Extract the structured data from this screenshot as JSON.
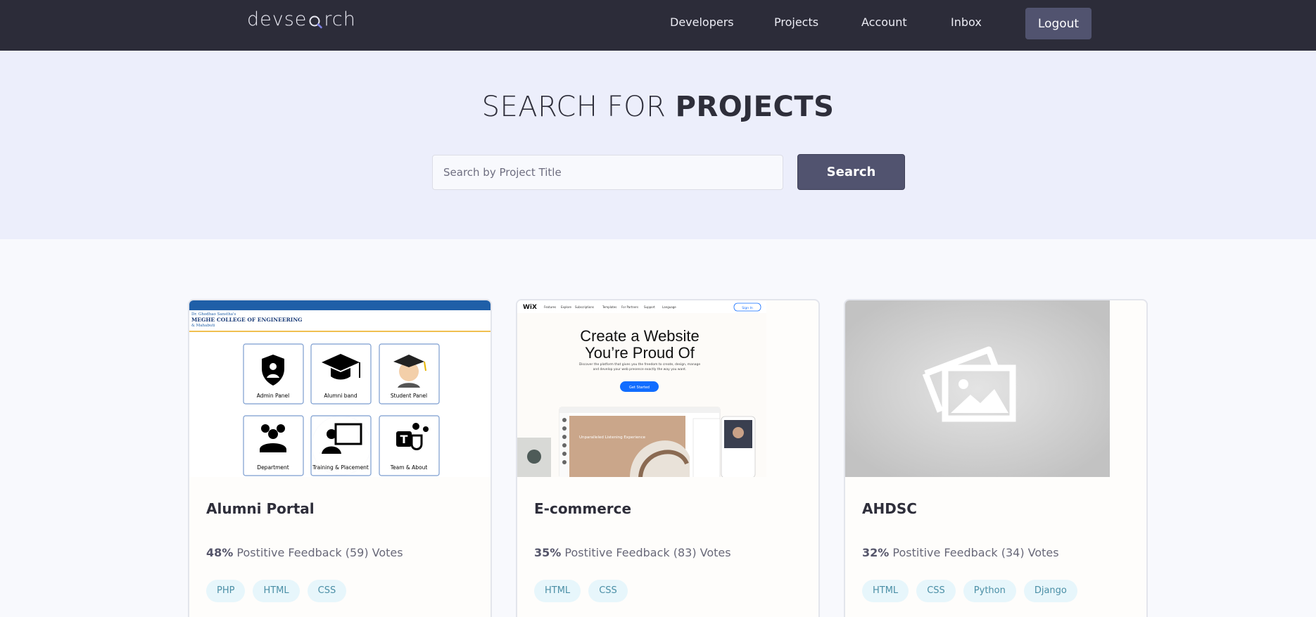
{
  "nav": {
    "logo": {
      "before": "devse",
      "after": "rch"
    },
    "links": [
      "Developers",
      "Projects",
      "Account",
      "Inbox"
    ],
    "logout": "Logout"
  },
  "hero": {
    "title_light": "SEARCH FOR",
    "title_bold": "PROJECTS",
    "search_placeholder": "Search by Project Title",
    "search_button": "Search"
  },
  "projects": [
    {
      "title": "Alumni Portal",
      "percent": "48%",
      "feedback": "Postitive Feedback (59) Votes",
      "tags": [
        "PHP",
        "HTML",
        "CSS"
      ],
      "thumb": {
        "header_small": "Dr. Ghodhao Sanstha's",
        "header_main": "MEGHE COLLEGE OF ENGINEERING",
        "header_sub": "& Mahabuti",
        "tiles": [
          "Admin Panel",
          "Alumni band",
          "Student Panel",
          "Department",
          "Training & Placement",
          "Team & About"
        ]
      }
    },
    {
      "title": "E-commerce",
      "percent": "35%",
      "feedback": "Postitive Feedback (83) Votes",
      "tags": [
        "HTML",
        "CSS"
      ],
      "thumb": {
        "brand": "WiX",
        "menu": [
          "Features",
          "Explore",
          "Subscriptions",
          "Templates",
          "For Partners",
          "Support",
          "Language"
        ],
        "signin": "Sign In",
        "headline_1": "Create a Website",
        "headline_2": "You’re Proud Of",
        "body": "Discover the platform that gives you the freedom to create, design, manage and develop your web presence exactly the way you want.",
        "cta": "Get Started",
        "panel_text": "Unparalleled Listening Experience"
      }
    },
    {
      "title": "AHDSC",
      "percent": "32%",
      "feedback": "Postitive Feedback (34) Votes",
      "tags": [
        "HTML",
        "CSS",
        "Python",
        "Django"
      ],
      "thumb": {
        "placeholder_icon": "image-placeholder-icon"
      }
    }
  ],
  "colors": {
    "header_bg": "#2c2c39",
    "hero_bg": "#eceefb",
    "button_bg": "#51536f",
    "tag_bg": "#e7f6fb",
    "tag_text": "#4b8fa6"
  }
}
